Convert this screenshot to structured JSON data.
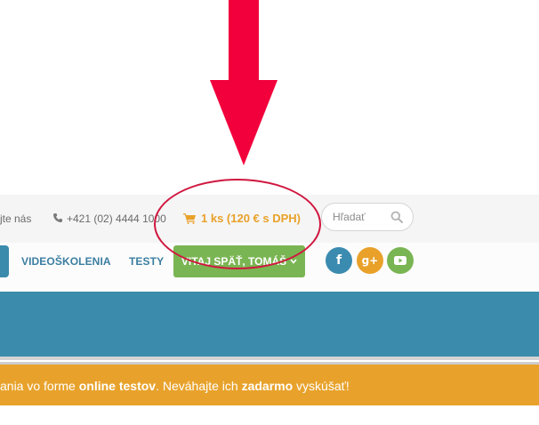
{
  "topbar": {
    "contact_text": "jte nás",
    "phone": "+421 (02) 4444 1000",
    "cart_label": "1 ks (120 € s DPH)",
    "search_placeholder": "Hľadať"
  },
  "nav": {
    "items": [
      {
        "label": "VIDEOŠKOLENIA"
      },
      {
        "label": "TESTY"
      }
    ],
    "welcome_label": "VITAJ SPÄŤ, TOMÁŠ"
  },
  "social": [
    {
      "icon": "facebook-icon",
      "glyph": "f",
      "color": "#3b8bb0"
    },
    {
      "icon": "google-plus-icon",
      "glyph": "g+",
      "color": "#e9a12a"
    },
    {
      "icon": "youtube-icon",
      "glyph": "▶",
      "color": "#7ab553"
    }
  ],
  "promo": {
    "part1": "ania vo forme ",
    "bold1": "online testov",
    "part2": ". Neváhajte ich ",
    "bold2": "zadarmo",
    "part3": " vyskúšať!"
  },
  "annotation": {
    "arrow_color": "#f2003c",
    "circle_color": "#d0173f"
  },
  "colors": {
    "accent_orange": "#e9a12a",
    "brand_blue": "#3a8bac",
    "brand_green": "#7ab553"
  }
}
